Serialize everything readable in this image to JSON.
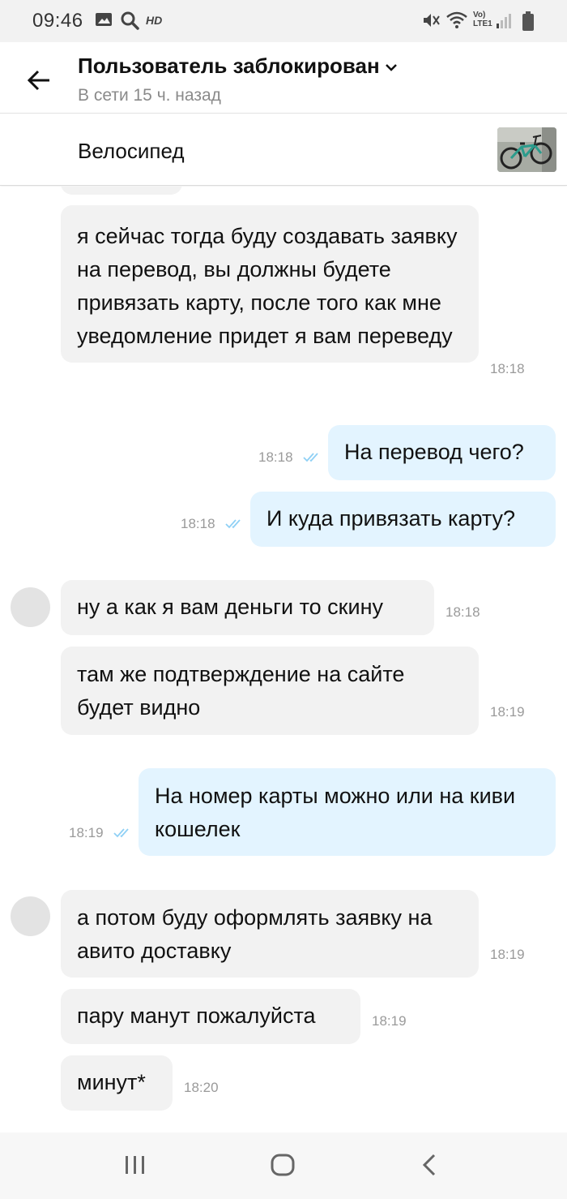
{
  "status_bar": {
    "time": "09:46",
    "hd_label": "HD",
    "network_label_1": "Vo)",
    "network_label_2": "LTE1",
    "icons": [
      "gallery-icon",
      "search-icon",
      "mute-icon",
      "wifi-icon",
      "signal-icon",
      "battery-icon"
    ]
  },
  "header": {
    "title": "Пользователь заблокирован",
    "subtitle": "В сети 15 ч. назад"
  },
  "item": {
    "title": "Велосипед",
    "thumbnail_icon": "bicycle-photo"
  },
  "messages": [
    {
      "direction": "in",
      "text": "я сейчас тогда буду создавать заявку на перевод, вы должны будете привязать карту, после того как мне уведомление придет я вам переведу",
      "time": "18:18"
    },
    {
      "direction": "out",
      "text": "На перевод чего?",
      "time": "18:18",
      "read": true
    },
    {
      "direction": "out",
      "text": "И куда привязать карту?",
      "time": "18:18",
      "read": true
    },
    {
      "direction": "in",
      "text": "ну а как я вам деньги то скину",
      "time": "18:18",
      "avatar": true
    },
    {
      "direction": "in",
      "text": "там же подтверждение на сайте будет видно",
      "time": "18:19"
    },
    {
      "direction": "out",
      "text": "На номер карты можно или на киви кошелек",
      "time": "18:19",
      "read": true
    },
    {
      "direction": "in",
      "text": "а потом буду оформлять заявку на авито доставку",
      "time": "18:19",
      "avatar": true
    },
    {
      "direction": "in",
      "text": "пару манут пожалуйста",
      "time": "18:19"
    },
    {
      "direction": "in",
      "text": "минут*",
      "time": "18:20"
    }
  ],
  "colors": {
    "incoming_bubble": "#f2f2f2",
    "outgoing_bubble": "#e3f4ff",
    "read_check": "#8fd0f5",
    "time_text": "#9a9a9a"
  },
  "nav_bar": {
    "icons": [
      "recent-apps-icon",
      "home-icon",
      "back-nav-icon"
    ]
  }
}
